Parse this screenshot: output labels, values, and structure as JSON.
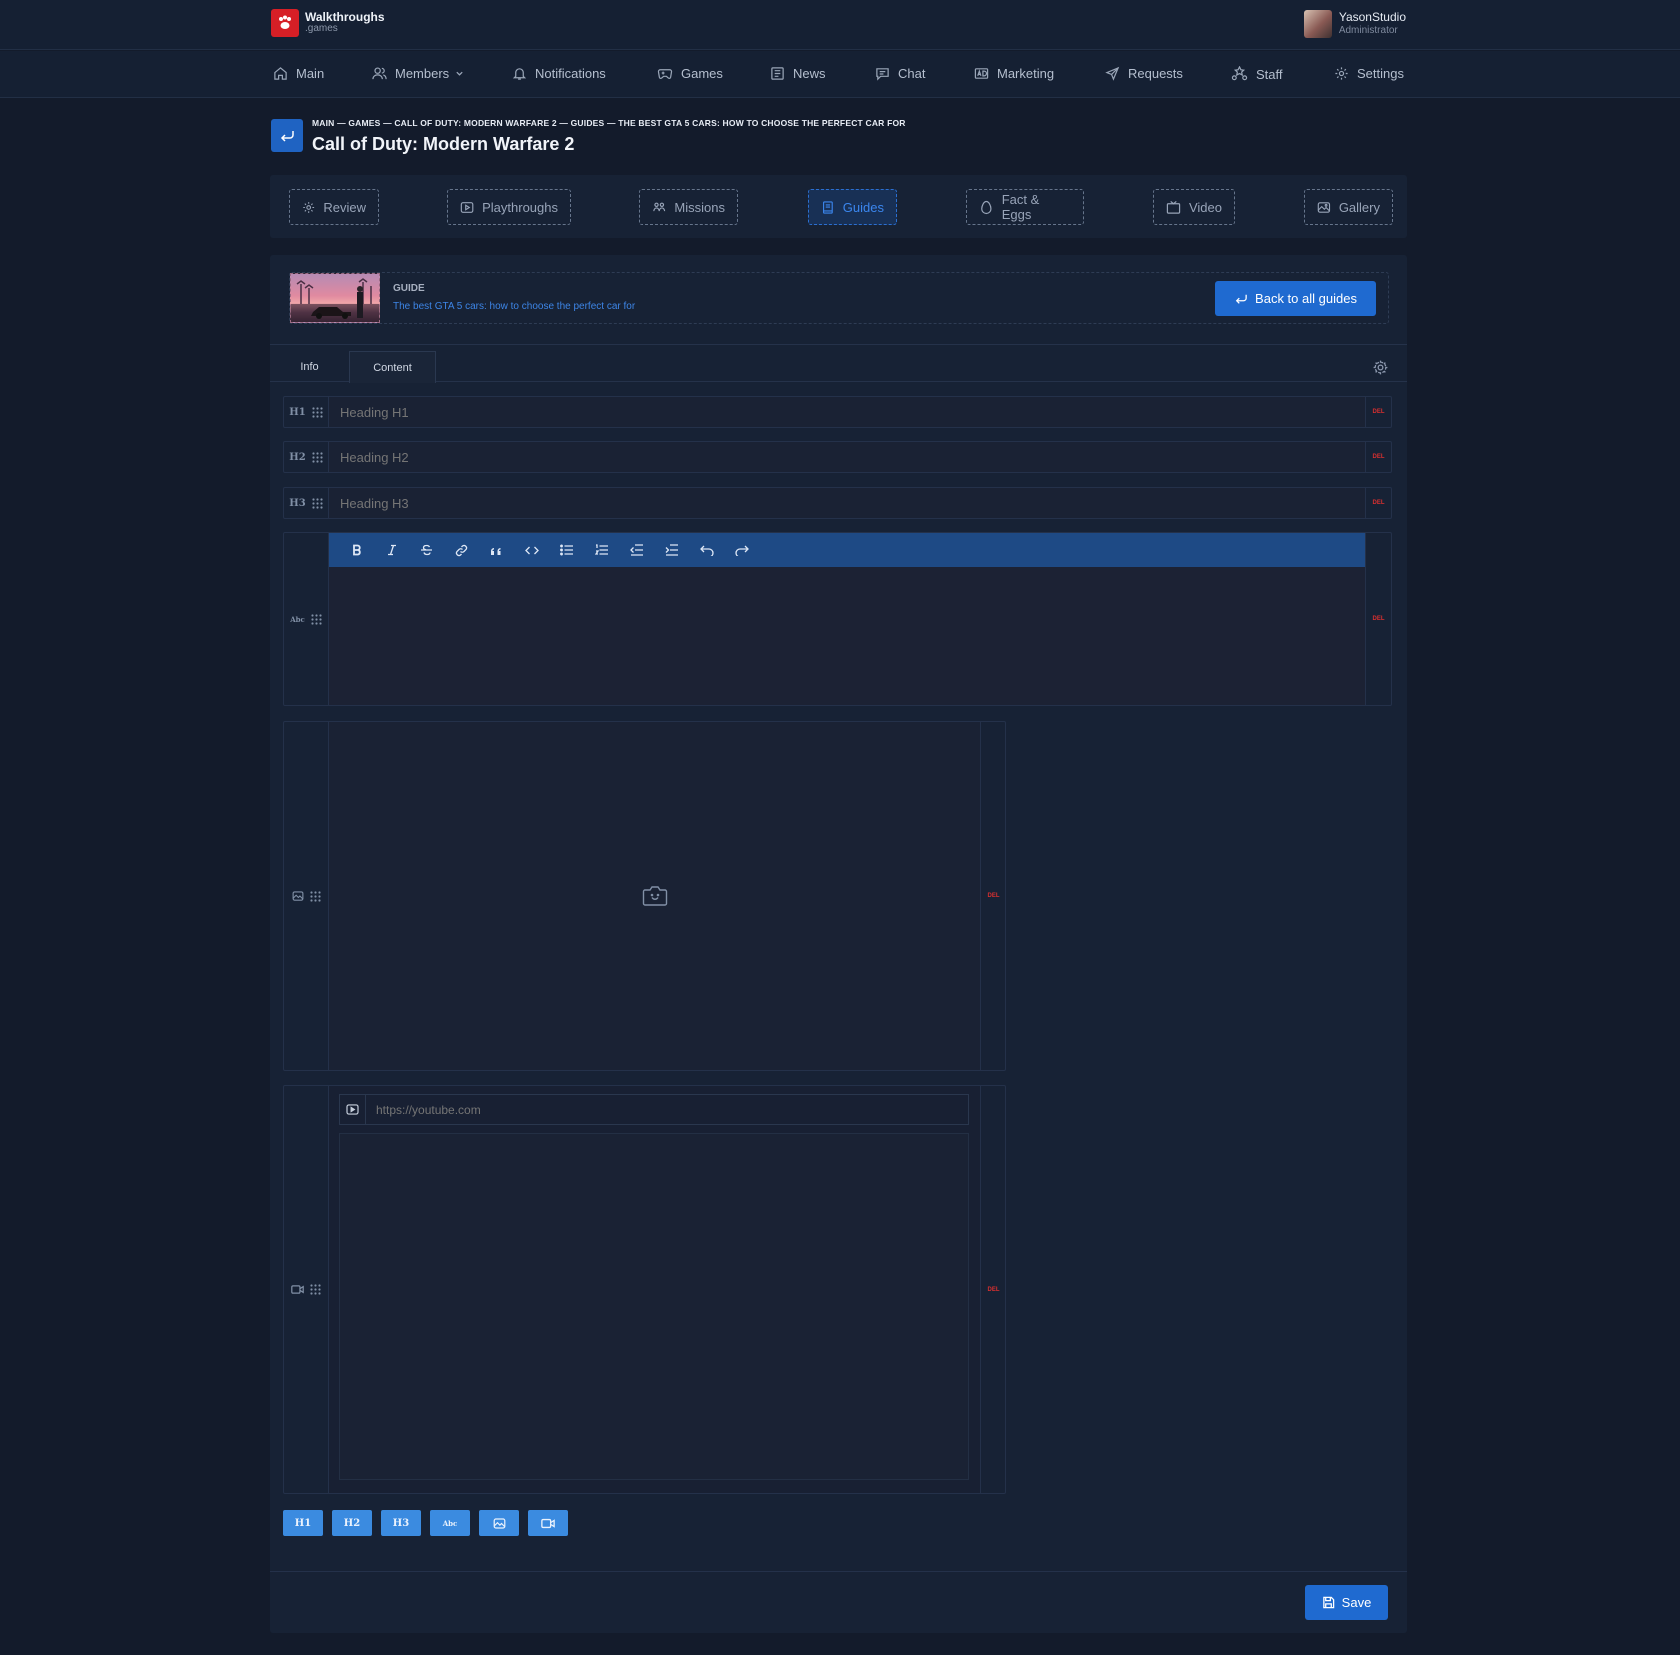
{
  "brand": {
    "title": "Walkthroughs",
    "subtitle": ".games",
    "color": "#d61f26"
  },
  "user": {
    "name": "YasonStudio",
    "role": "Administrator"
  },
  "nav": [
    {
      "label": "Main",
      "icon": "home-icon"
    },
    {
      "label": "Members",
      "icon": "users-icon",
      "dropdown": true
    },
    {
      "label": "Notifications",
      "icon": "bell-icon"
    },
    {
      "label": "Games",
      "icon": "gamepad-icon"
    },
    {
      "label": "News",
      "icon": "newspaper-icon"
    },
    {
      "label": "Chat",
      "icon": "chat-icon"
    },
    {
      "label": "Marketing",
      "icon": "ad-icon"
    },
    {
      "label": "Requests",
      "icon": "send-icon"
    },
    {
      "label": "Staff",
      "icon": "staff-icon"
    },
    {
      "label": "Settings",
      "icon": "gear-icon"
    }
  ],
  "breadcrumb": "MAIN — GAMES — CALL OF DUTY: MODERN WARFARE 2 — GUIDES — THE BEST GTA 5 CARS: HOW TO CHOOSE THE PERFECT CAR FOR",
  "page_title": "Call of Duty: Modern Warfare 2",
  "section_tabs": [
    {
      "label": "Review",
      "icon": "gear-icon"
    },
    {
      "label": "Playthroughs",
      "icon": "play-icon"
    },
    {
      "label": "Missions",
      "icon": "missions-icon"
    },
    {
      "label": "Guides",
      "icon": "book-icon",
      "active": true
    },
    {
      "label": "Fact & Eggs",
      "icon": "egg-icon"
    },
    {
      "label": "Video",
      "icon": "tv-icon"
    },
    {
      "label": "Gallery",
      "icon": "image-icon"
    }
  ],
  "guide": {
    "label": "GUIDE",
    "name": "The best GTA 5 cars: how to choose the perfect car for",
    "back_label": "Back to all guides"
  },
  "content_tabs": [
    {
      "label": "Info"
    },
    {
      "label": "Content",
      "active": true
    }
  ],
  "blocks": {
    "h1": {
      "tag": "H1",
      "placeholder": "Heading H1"
    },
    "h2": {
      "tag": "H2",
      "placeholder": "Heading H2"
    },
    "h3": {
      "tag": "H3",
      "placeholder": "Heading H3"
    },
    "text_tag": "Abc",
    "del_label": "DEL",
    "video_placeholder": "https://youtube.com"
  },
  "toolbar": [
    "bold-icon",
    "italic-icon",
    "strikethrough-icon",
    "link-icon",
    "quote-icon",
    "code-icon",
    "bullet-list-icon",
    "numbered-list-icon",
    "outdent-icon",
    "indent-icon",
    "undo-icon",
    "redo-icon"
  ],
  "add_buttons": [
    {
      "label": "H1"
    },
    {
      "label": "H2"
    },
    {
      "label": "H3"
    },
    {
      "label": "Abc"
    },
    {
      "icon": "image-icon"
    },
    {
      "icon": "video-icon"
    }
  ],
  "save_label": "Save",
  "colors": {
    "accent": "#1f6ad0",
    "danger": "#d92f2f",
    "background": "#131b2b"
  }
}
